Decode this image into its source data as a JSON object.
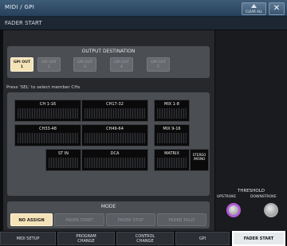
{
  "window": {
    "title": "MIDI / GPI",
    "clear_all": "CLEAR ALL",
    "close": "✕"
  },
  "section": {
    "title": "FADER START"
  },
  "output_destination": {
    "title": "OUTPUT DESTINATION",
    "buttons": [
      {
        "line1": "GPI OUT",
        "line2": "1",
        "active": true
      },
      {
        "line1": "GPI OUT",
        "line2": "2",
        "active": false
      },
      {
        "line1": "GPI OUT",
        "line2": "3",
        "active": false
      },
      {
        "line1": "GPI OUT",
        "line2": "4",
        "active": false
      },
      {
        "line1": "GPI OUT",
        "line2": "5",
        "active": false
      }
    ]
  },
  "members": {
    "instruction": "Press 'SEL' to select member CHs",
    "groups": {
      "ch1_16": "CH 1-16",
      "ch17_32": "CH17-32",
      "mix1_8": "MIX 1-8",
      "ch33_48": "CH33-48",
      "ch49_64": "CH49-64",
      "mix9_16": "MIX 9-16",
      "stin": "ST IN",
      "dca": "DCA",
      "matrix": "MATRIX",
      "stereo": "STEREO",
      "mono": "/MONO"
    }
  },
  "mode": {
    "title": "MODE",
    "buttons": [
      "NO ASSIGN",
      "FADER START",
      "FADER STOP",
      "FADER TALLY"
    ],
    "selected": "NO ASSIGN"
  },
  "threshold": {
    "title": "THRESHOLD",
    "upstroke": "UPSTROKE",
    "downstroke": "DOWNSTROKE"
  },
  "tabs": {
    "midi_setup": "MIDI SETUP",
    "program_change_1": "PROGRAM",
    "program_change_2": "CHANGE",
    "control_change_1": "CONTROL",
    "control_change_2": "CHANGE",
    "gpi": "GPI",
    "fader_start": "FADER START",
    "active": "FADER START"
  },
  "colors": {
    "selected": "#f4e3b7",
    "titlebar": "#3e5c78",
    "knob_ring": "#b35bd6"
  }
}
